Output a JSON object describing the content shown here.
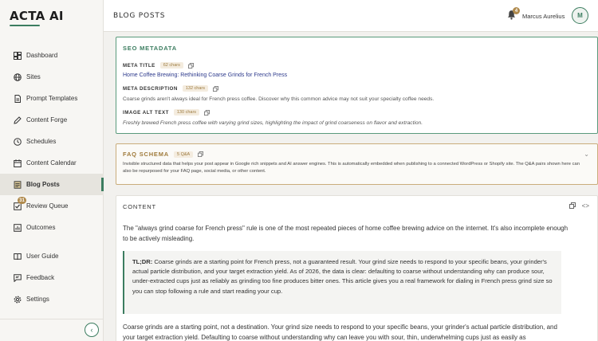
{
  "app": {
    "logo": "ACTA AI"
  },
  "sidebar": {
    "items": [
      {
        "label": "Dashboard",
        "icon": "grid-icon"
      },
      {
        "label": "Sites",
        "icon": "globe-icon"
      },
      {
        "label": "Prompt Templates",
        "icon": "document-icon"
      },
      {
        "label": "Content Forge",
        "icon": "pencil-icon"
      },
      {
        "label": "Schedules",
        "icon": "clock-icon"
      },
      {
        "label": "Content Calendar",
        "icon": "calendar-icon"
      },
      {
        "label": "Blog Posts",
        "icon": "file-text-icon",
        "active": true
      },
      {
        "label": "Review Queue",
        "icon": "check-square-icon",
        "badge": "31"
      },
      {
        "label": "Outcomes",
        "icon": "bar-chart-icon"
      },
      {
        "label": "User Guide",
        "icon": "book-icon"
      },
      {
        "label": "Feedback",
        "icon": "message-icon"
      },
      {
        "label": "Settings",
        "icon": "gear-icon"
      }
    ],
    "collapse_icon": "chevron-left-icon"
  },
  "header": {
    "title": "BLOG POSTS",
    "notification_count": "4",
    "user_name": "Marcus Aurelius",
    "avatar_initial": "M"
  },
  "seo": {
    "title": "SEO METADATA",
    "meta_title_label": "META TITLE",
    "meta_title_chars": "62 chars",
    "meta_title_value": "Home Coffee Brewing: Rethinking Coarse Grinds for French Press",
    "meta_desc_label": "META DESCRIPTION",
    "meta_desc_chars": "132 chars",
    "meta_desc_value": "Coarse grinds aren't always ideal for French press coffee. Discover why this common advice may not suit your specialty coffee needs.",
    "alt_label": "IMAGE ALT TEXT",
    "alt_chars": "130 chars",
    "alt_value": "Freshly brewed French press coffee with varying grind sizes, highlighting the impact of grind coarseness on flavor and extraction."
  },
  "faq": {
    "title": "FAQ SCHEMA",
    "count": "5 Q&A",
    "description": "Invisible structured data that helps your post appear in Google rich snippets and AI answer engines. This is automatically embedded when publishing to a connected WordPress or Shopify site. The Q&A pairs shown here can also be repurposed for your FAQ page, social media, or other content."
  },
  "content": {
    "title": "CONTENT",
    "intro": "The \"always grind coarse for French press\" rule is one of the most repeated pieces of home coffee brewing advice on the internet. It's also incomplete enough to be actively misleading.",
    "tldr_label": "TL;DR:",
    "tldr_text": " Coarse grinds are a starting point for French press, not a guaranteed result. Your grind size needs to respond to your specific beans, your grinder's actual particle distribution, and your target extraction yield. As of 2026, the data is clear: defaulting to coarse without understanding why can produce sour, under-extracted cups just as reliably as grinding too fine produces bitter ones. This article gives you a real framework for dialing in French press grind size so you can stop following a rule and start reading your cup.",
    "body": "Coarse grinds are a starting point, not a destination. Your grind size needs to respond to your specific beans, your grinder's actual particle distribution, and your target extraction yield. Defaulting to coarse without understanding why can leave you with sour, thin, underwhelming cups just as easily as"
  }
}
